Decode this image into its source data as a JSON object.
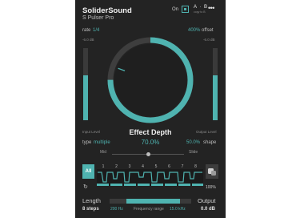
{
  "header": {
    "brand": "SoliderSound",
    "product": "S Pulser Pro",
    "power_label": "On",
    "ab_label": "A · B",
    "ab_sub": "copy to B",
    "more_icon": "•••"
  },
  "controls": {
    "rate_label": "rate",
    "rate_value": "1/4",
    "offset_value": "400%",
    "offset_label": "offset",
    "db_left": "-6.0 dB",
    "db_right": "-6.0 dB",
    "input_label": "Input Level",
    "output_level_label": "Output Level",
    "dial_level": 0.75
  },
  "depth": {
    "title": "Effect Depth",
    "type_label": "type",
    "type_value": "multiple",
    "value": "70.0%",
    "shape_value": "50.0%",
    "shape_label": "shape"
  },
  "mid_slide": {
    "mid_label": "Mid",
    "slide_label": "Slide"
  },
  "sequencer": {
    "all_label": "All",
    "steps": [
      "1",
      "2",
      "3",
      "4",
      "5",
      "6",
      "7",
      "8"
    ],
    "percent": "100%",
    "reset_icon": "↻"
  },
  "footer": {
    "length_label": "Length",
    "length_value": "8 steps",
    "freq_low": "200 Hz",
    "freq_label": "Frequency range",
    "freq_high": "15.0 kHz",
    "output_label": "Output",
    "output_value": "0.0 dB"
  },
  "colors": {
    "accent": "#4fb3b0",
    "panel": "#232323"
  }
}
